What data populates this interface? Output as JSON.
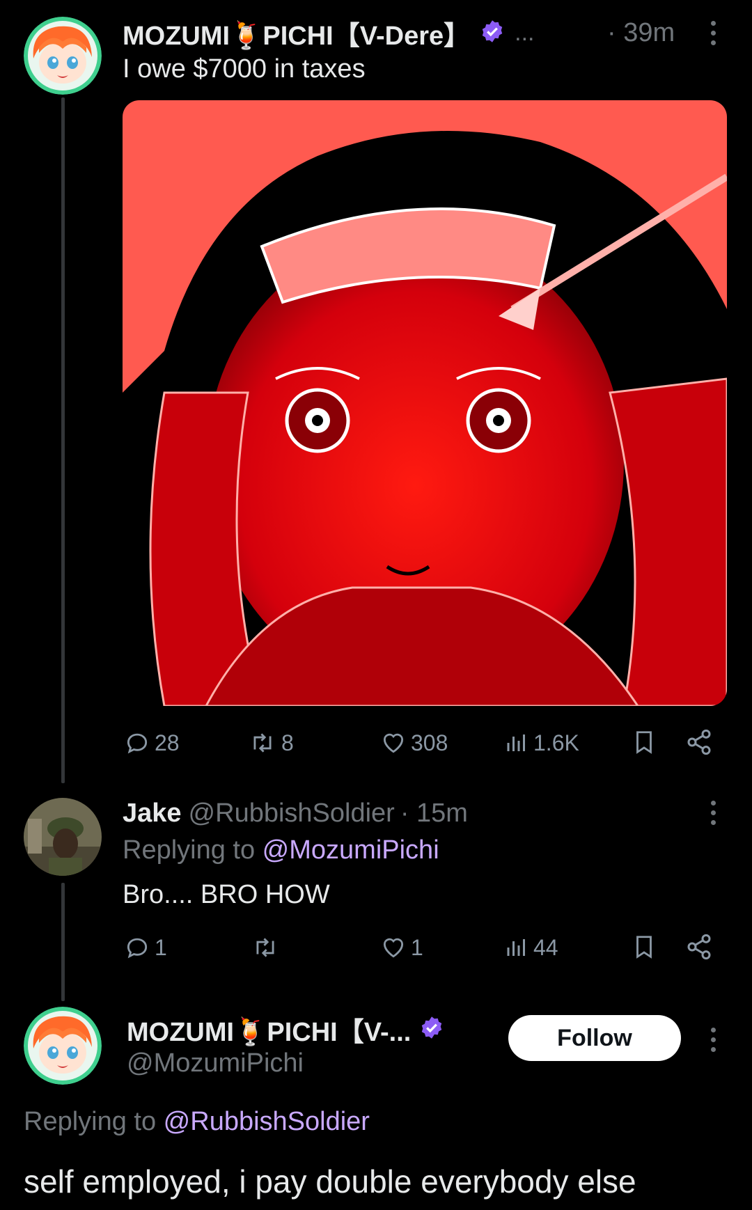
{
  "tweet1": {
    "display_name": "MOZUMI🍹PICHI【V-Dere】",
    "ellipsis": "...",
    "time": "· 39m",
    "text": "I owe $7000 in taxes",
    "actions": {
      "replies": "28",
      "retweets": "8",
      "likes": "308",
      "views": "1.6K"
    }
  },
  "tweet2": {
    "display_name": "Jake",
    "handle": "@RubbishSoldier",
    "time": "· 15m",
    "replying_prefix": "Replying to ",
    "replying_to": "@MozumiPichi",
    "text": "Bro.... BRO HOW",
    "actions": {
      "replies": "1",
      "retweets": "",
      "likes": "1",
      "views": "44"
    }
  },
  "tweet3": {
    "display_name": "MOZUMI🍹PICHI【V-...",
    "handle": "@MozumiPichi",
    "follow_label": "Follow",
    "replying_prefix": "Replying to ",
    "replying_to": "@RubbishSoldier",
    "text": "self employed, i pay double everybody else"
  },
  "colors": {
    "background": "#000000",
    "text": "#e7e9ea",
    "muted": "#71767b",
    "mention": "#c9a9ff",
    "verified": "#8c5cf5",
    "media_red": "#e0000a"
  },
  "icons": [
    "reply-icon",
    "retweet-icon",
    "like-icon",
    "views-icon",
    "bookmark-icon",
    "share-icon",
    "verified-icon",
    "more-icon"
  ]
}
